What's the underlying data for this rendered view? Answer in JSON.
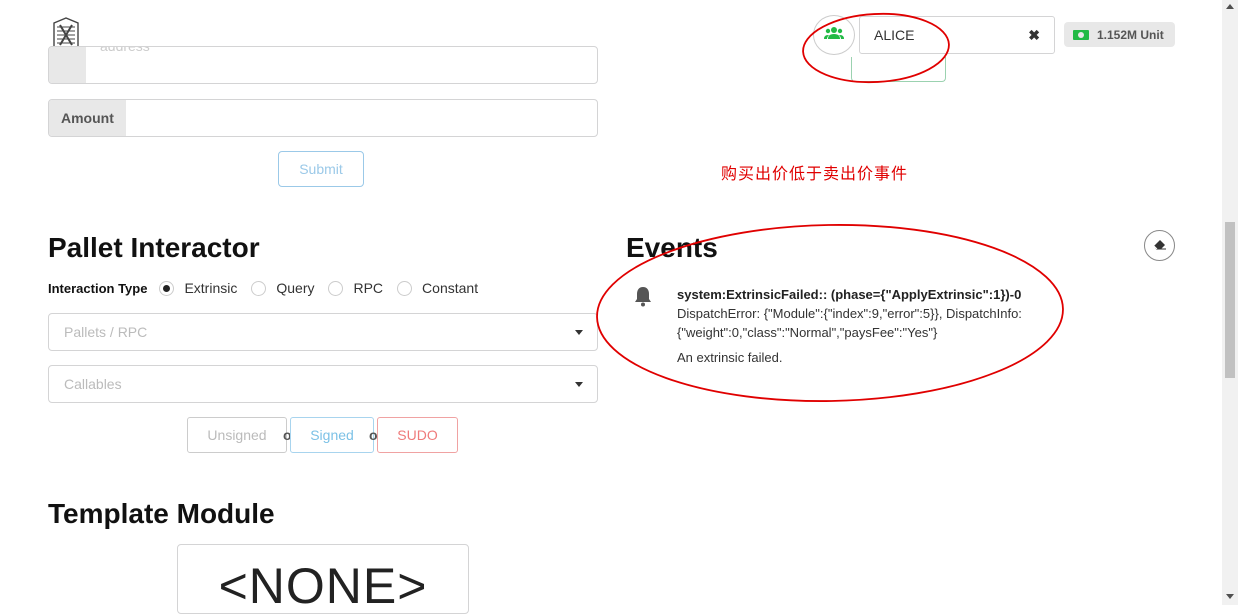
{
  "header": {
    "account_name": "ALICE",
    "clear_glyph": "✖",
    "balance": "1.152M Unit"
  },
  "transfer_form": {
    "address_placeholder": "address",
    "amount_label": "Amount",
    "amount_value": "",
    "submit_label": "Submit"
  },
  "annotation": {
    "text": "购买出价低于卖出价事件",
    "color": "#e00000"
  },
  "pallet_interactor": {
    "title": "Pallet Interactor",
    "interaction_type_label": "Interaction Type",
    "options": [
      {
        "label": "Extrinsic",
        "selected": true
      },
      {
        "label": "Query",
        "selected": false
      },
      {
        "label": "RPC",
        "selected": false
      },
      {
        "label": "Constant",
        "selected": false
      }
    ],
    "pallets_placeholder": "Pallets / RPC",
    "callables_placeholder": "Callables",
    "buttons": {
      "unsigned": "Unsigned",
      "signed": "Signed",
      "sudo": "SUDO",
      "or": "or"
    }
  },
  "events": {
    "title": "Events",
    "items": [
      {
        "icon": "bell-icon",
        "header": "system:ExtrinsicFailed:: (phase={\"ApplyExtrinsic\":1})-0",
        "detail": "DispatchError: {\"Module\":{\"index\":9,\"error\":5}}, DispatchInfo: {\"weight\":0,\"class\":\"Normal\",\"paysFee\":\"Yes\"}",
        "description": "An extrinsic failed."
      }
    ]
  },
  "template_module": {
    "title": "Template Module",
    "value": "<NONE>"
  },
  "colors": {
    "signed": "#7cc1e6",
    "sudo": "#ef7b7b",
    "account_icon": "#21ba45"
  }
}
